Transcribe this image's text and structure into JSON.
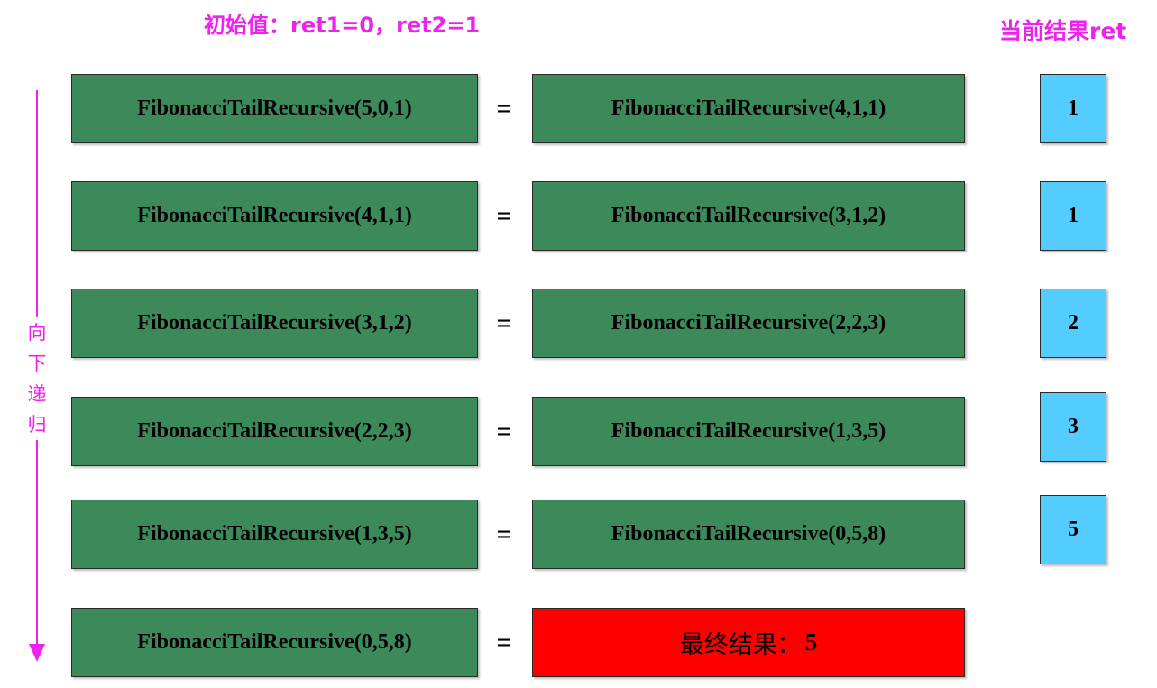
{
  "header": {
    "initial_values": "初始值：ret1=0，ret2=1",
    "current_result_title": "当前结果ret"
  },
  "direction_label": [
    "向",
    "下",
    "递",
    "归"
  ],
  "steps": [
    {
      "left": "FibonacciTailRecursive(5,0,1)",
      "right": "FibonacciTailRecursive(4,1,1)",
      "ret": "1"
    },
    {
      "left": "FibonacciTailRecursive(4,1,1)",
      "right": "FibonacciTailRecursive(3,1,2)",
      "ret": "1"
    },
    {
      "left": "FibonacciTailRecursive(3,1,2)",
      "right": "FibonacciTailRecursive(2,2,3)",
      "ret": "2"
    },
    {
      "left": "FibonacciTailRecursive(2,2,3)",
      "right": "FibonacciTailRecursive(1,3,5)",
      "ret": "3"
    },
    {
      "left": "FibonacciTailRecursive(1,3,5)",
      "right": "FibonacciTailRecursive(0,5,8)",
      "ret": "5"
    }
  ],
  "final_step": {
    "left": "FibonacciTailRecursive(0,5,8)",
    "result_label": "最终结果：",
    "result_value": "5"
  },
  "equals_sign": "=",
  "colors": {
    "box_fill": "#3c8a5a",
    "result_fill": "#ff0000",
    "ret_fill": "#55ccff",
    "accent": "#ee22ee"
  }
}
